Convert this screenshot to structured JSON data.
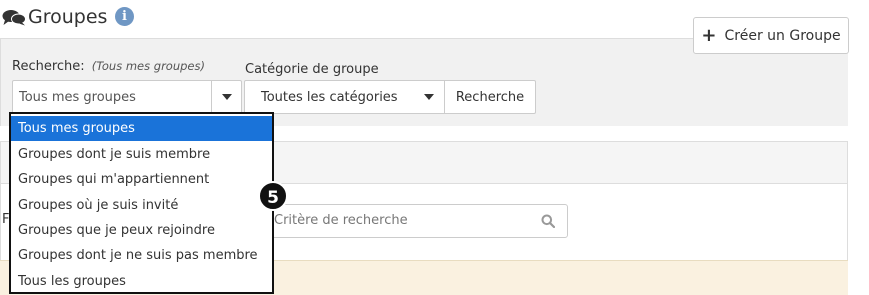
{
  "header": {
    "title": "Groupes",
    "info_glyph": "i",
    "icons": {
      "title": "chat-bubbles-icon",
      "info": "info-circle-icon"
    }
  },
  "toolbar": {
    "create_label": "Créer un Groupe",
    "create_icon": "plus-icon"
  },
  "filters": {
    "search_label": "Recherche:",
    "search_hint": "(Tous mes groupes)",
    "search_value": "Tous mes groupes",
    "category_label": "Catégorie de groupe",
    "category_value": "Toutes les catégories",
    "search_button": "Recherche"
  },
  "dropdown": {
    "items": [
      {
        "label": "Tous mes groupes",
        "selected": true
      },
      {
        "label": "Groupes dont je suis membre",
        "selected": false
      },
      {
        "label": "Groupes qui m'appartiennent",
        "selected": false
      },
      {
        "label": "Groupes où je suis invité",
        "selected": false
      },
      {
        "label": "Groupes que je peux rejoindre",
        "selected": false
      },
      {
        "label": "Groupes dont je ne suis pas membre",
        "selected": false
      },
      {
        "label": "Tous les groupes",
        "selected": false
      }
    ]
  },
  "panel": {
    "cut_text": "F",
    "criteria_placeholder": "Critère de recherche"
  },
  "annotation": {
    "step": "5"
  },
  "colors": {
    "selected_bg": "#1a73d9",
    "info_icon": "#6f97c4",
    "filter_band": "#f1f1f1",
    "warning_strip": "#faf1e0"
  }
}
